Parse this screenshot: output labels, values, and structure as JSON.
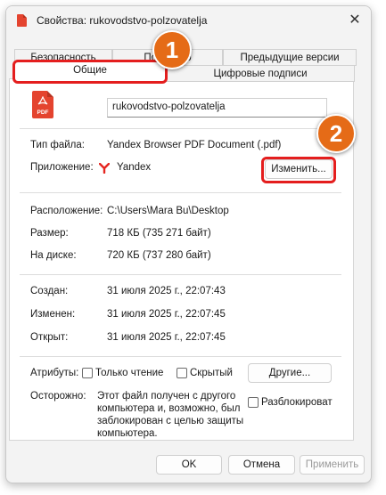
{
  "window": {
    "title": "Свойства: rukovodstvo-polzovatelja",
    "close_glyph": "✕"
  },
  "tabs": {
    "row1": [
      "Безопасность",
      "Подробно",
      "Предыдущие версии"
    ],
    "row2": [
      "Общие",
      "Цифровые подписи"
    ],
    "active": "Общие"
  },
  "file": {
    "icon_label": "PDF",
    "name": "rukovodstvo-polzovatelja",
    "type_label": "Тип файла:",
    "type_value": "Yandex Browser PDF Document (.pdf)",
    "app_label": "Приложение:",
    "app_value": "Yandex",
    "change_button": "Изменить...",
    "location_label": "Расположение:",
    "location_value": "C:\\Users\\Mara Bu\\Desktop",
    "size_label": "Размер:",
    "size_value": "718 КБ (735 271 байт)",
    "disk_label": "На диске:",
    "disk_value": "720 КБ (737 280 байт)",
    "created_label": "Создан:",
    "created_value": "31 июля 2025 г., 22:07:43",
    "modified_label": "Изменен:",
    "modified_value": "31 июля 2025 г., 22:07:45",
    "opened_label": "Открыт:",
    "opened_value": "31 июля 2025 г., 22:07:45"
  },
  "attributes": {
    "label": "Атрибуты:",
    "readonly": "Только чтение",
    "hidden": "Скрытый",
    "other_button": "Другие..."
  },
  "security": {
    "label": "Осторожно:",
    "text_lines": [
      "Этот файл получен с другого",
      "компьютера и, возможно, был",
      "заблокирован с целью защиты",
      "компьютера."
    ],
    "unblock": "Разблокировать"
  },
  "footer": {
    "ok": "OK",
    "cancel": "Отмена",
    "apply": "Применить"
  },
  "annotations": {
    "badge1": "1",
    "badge2": "2",
    "highlight_color": "#e41e1e",
    "badge_color": "#e56b17"
  }
}
